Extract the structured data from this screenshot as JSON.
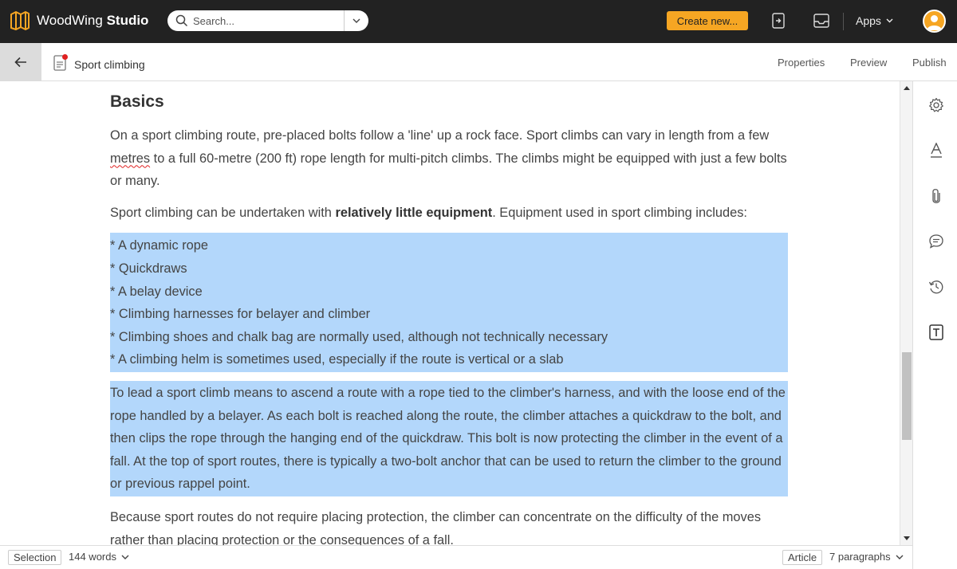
{
  "topbar": {
    "brand_regular": "WoodWing ",
    "brand_bold": "Studio",
    "search_placeholder": "Search...",
    "create_button": "Create new...",
    "apps_label": "Apps"
  },
  "docbar": {
    "title": "Sport climbing",
    "tabs": [
      "Properties",
      "Preview",
      "Publish"
    ]
  },
  "article": {
    "heading": "Basics",
    "p1_a": "On a sport climbing route, pre-placed bolts follow a 'line' up a rock face. Sport climbs can vary in length from a few ",
    "p1_misspelled": "metres",
    "p1_b": " to a full 60-metre (200 ft) rope length for multi-pitch climbs. The climbs might be equipped with just a few bolts or many.",
    "p2_a": "Sport climbing can be undertaken with ",
    "p2_bold": "relatively little equipment",
    "p2_b": ". Equipment used in sport climbing includes:",
    "list": [
      "* A dynamic rope",
      "* Quickdraws",
      "* A belay device",
      "* Climbing harnesses for belayer and climber",
      "* Climbing shoes and chalk bag are normally used, although not technically necessary",
      "* A climbing helm is sometimes used, especially if the route is vertical or a slab"
    ],
    "p3": "To lead a sport climb means to ascend a route with a rope tied to the climber's harness, and with the loose end of the rope handled by a belayer. As each bolt is reached along the route, the climber attaches a quickdraw to the bolt, and then clips the rope through the hanging end of the quickdraw. This bolt is now protecting the climber in the event of a fall. At the top of sport routes, there is typically a two-bolt anchor that can be used to return the climber to the ground or previous rappel point.",
    "p4": "Because sport routes do not require placing protection, the climber can concentrate on the difficulty of the moves rather than placing protection or the consequences of a fall."
  },
  "statusbar": {
    "selection_label": "Selection",
    "word_count": "144 words",
    "component_label": "Article",
    "paragraph_count": "7 paragraphs"
  },
  "sidebar_icons": [
    "settings-icon",
    "typography-icon",
    "attachment-icon",
    "comments-icon",
    "history-icon",
    "text-style-icon"
  ],
  "colors": {
    "topbar_bg": "#222222",
    "accent": "#f6a623",
    "selection": "#b3d7fb"
  }
}
